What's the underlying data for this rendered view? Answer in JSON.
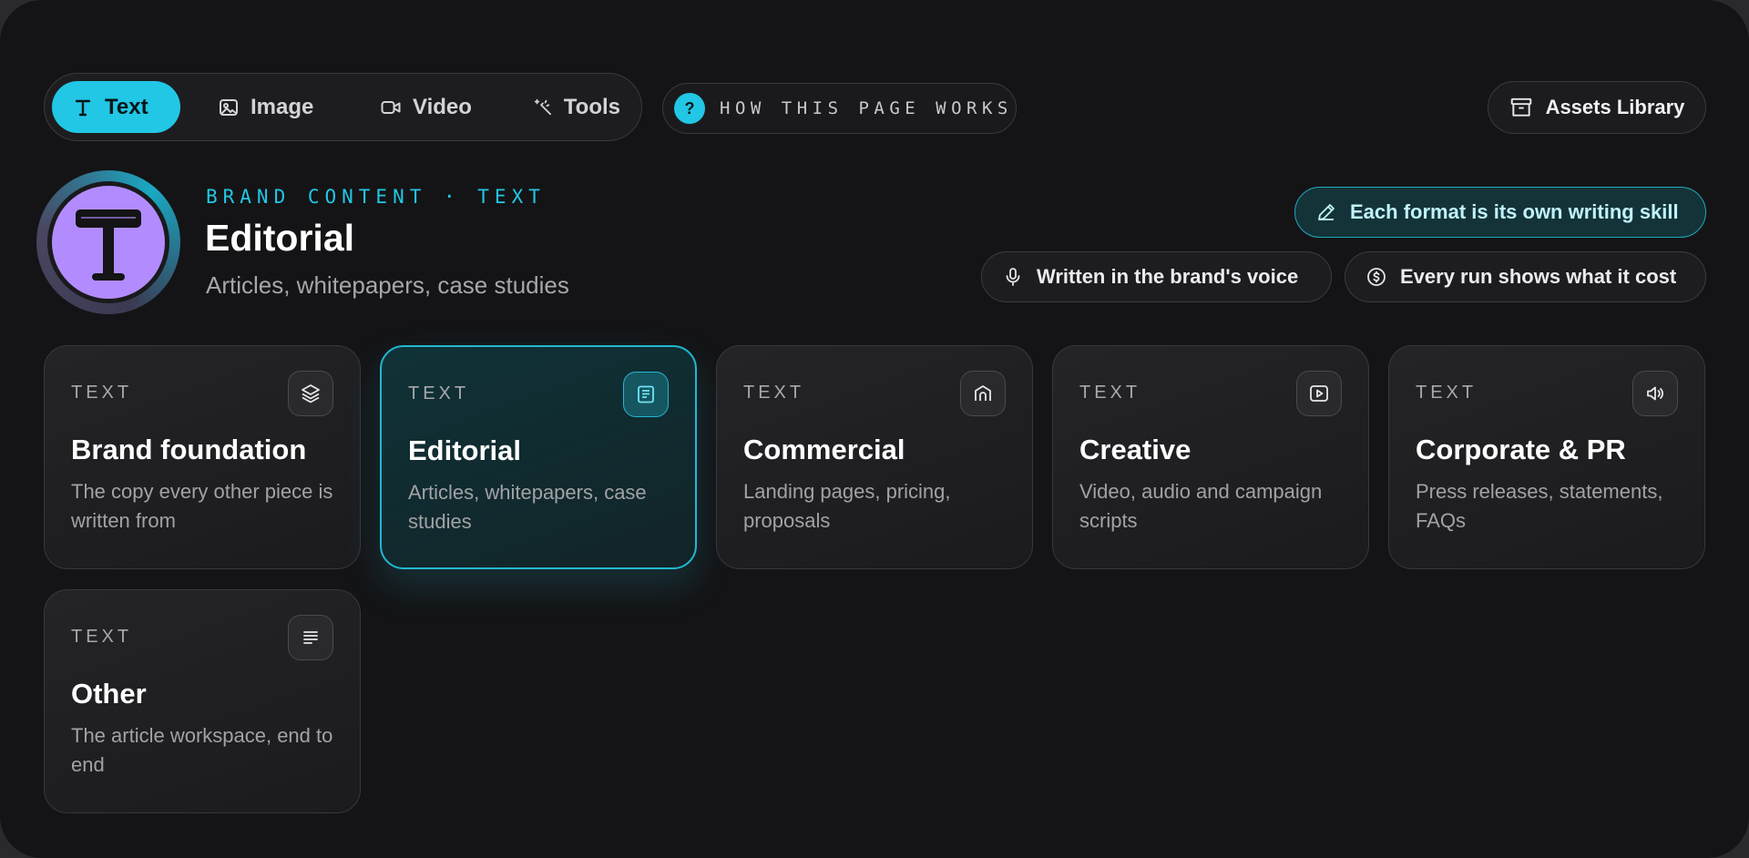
{
  "nav": {
    "tabs": [
      {
        "label": "Text",
        "icon": "text-icon",
        "active": true
      },
      {
        "label": "Image",
        "icon": "image-icon",
        "active": false
      },
      {
        "label": "Video",
        "icon": "video-icon",
        "active": false
      },
      {
        "label": "Tools",
        "icon": "tools-icon",
        "active": false
      }
    ],
    "help_icon": "?",
    "help_label": "HOW THIS PAGE WORKS",
    "assets_label": "Assets Library"
  },
  "header": {
    "eyebrow": "BRAND CONTENT · TEXT",
    "title": "Editorial",
    "subtitle": "Articles, whitepapers, case studies",
    "pills": [
      {
        "label": "Each format is its own writing skill",
        "icon": "pen-icon"
      },
      {
        "label": "Written in the brand's voice",
        "icon": "microphone-icon"
      },
      {
        "label": "Every run shows what it cost",
        "icon": "dollar-coin-icon"
      }
    ]
  },
  "cards": [
    {
      "kind": "TEXT",
      "title": "Brand foundation",
      "desc": "The copy every other piece is written from",
      "icon": "layers-icon",
      "selected": false
    },
    {
      "kind": "TEXT",
      "title": "Editorial",
      "desc": "Articles, whitepapers, case studies",
      "icon": "newspaper-icon",
      "selected": true
    },
    {
      "kind": "TEXT",
      "title": "Commercial",
      "desc": "Landing pages, pricing, proposals",
      "icon": "storefront-icon",
      "selected": false
    },
    {
      "kind": "TEXT",
      "title": "Creative",
      "desc": "Video, audio and campaign scripts",
      "icon": "play-icon",
      "selected": false
    },
    {
      "kind": "TEXT",
      "title": "Corporate & PR",
      "desc": "Press releases, statements, FAQs",
      "icon": "megaphone-icon",
      "selected": false
    },
    {
      "kind": "TEXT",
      "title": "Other",
      "desc": "The article workspace, end to end",
      "icon": "text-lines-icon",
      "selected": false
    }
  ],
  "colors": {
    "accent": "#22c7e5",
    "background": "#141416",
    "avatar": "#b28cff"
  }
}
